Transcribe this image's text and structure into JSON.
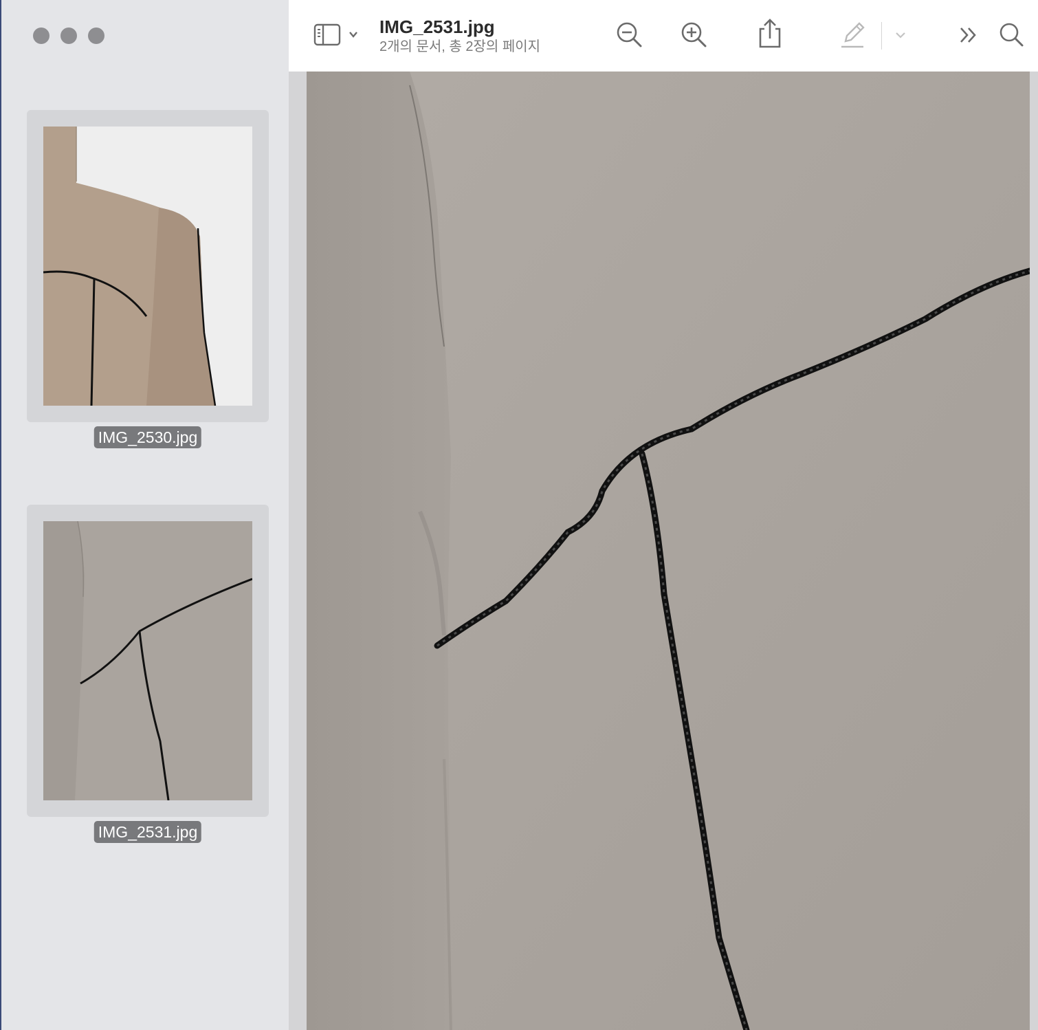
{
  "window": {
    "traffic_lights": [
      "close",
      "minimize",
      "zoom"
    ]
  },
  "sidebar": {
    "thumbnails": [
      {
        "label": "IMG_2530.jpg",
        "selected": false
      },
      {
        "label": "IMG_2531.jpg",
        "selected": true
      }
    ]
  },
  "toolbar": {
    "title": "IMG_2531.jpg",
    "subtitle": "2개의 문서, 총 2장의 페이지",
    "icons": [
      "sidebar-toggle-icon",
      "chevron-down-icon",
      "zoom-out-icon",
      "zoom-in-icon",
      "share-icon",
      "markup-pencil-icon",
      "chevron-down-icon",
      "more-chevrons-icon",
      "search-icon"
    ]
  },
  "colors": {
    "sidebar_bg": "#e4e5e8",
    "label_bg": "#78797c",
    "fabric_tan": "#b3a393",
    "fabric_gray": "#a9a39d",
    "stitch": "#111111"
  }
}
